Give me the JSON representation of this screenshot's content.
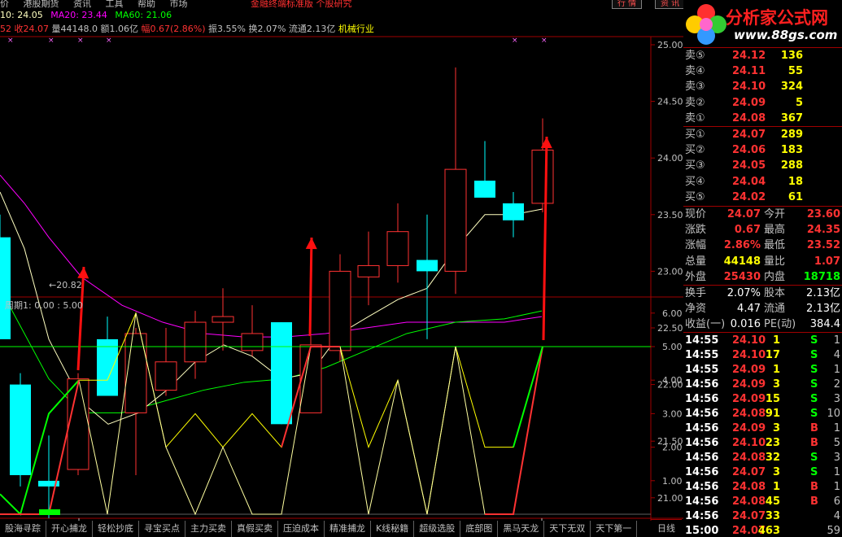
{
  "menu": {
    "items": [
      "价",
      "港股期货",
      "资讯",
      "工具",
      "帮助",
      "市场"
    ],
    "title": "金融终端标准版 个股研究",
    "right_buttons": [
      "行 情",
      "资 讯"
    ]
  },
  "watermark": {
    "brand": "分析家公式网",
    "url": "www.88gs.com"
  },
  "ma_legend": {
    "ma10": "10: 24.05",
    "ma20": "MA20: 23.44",
    "ma60": "MA60: 21.06"
  },
  "quote_line": {
    "close": "52 收24.07",
    "volume": "量44148.0",
    "amount": "额1.06亿",
    "change": "幅0.67(2.86%)",
    "amplitude": "振3.55%",
    "turnover": "换2.07%",
    "float": "流通2.13亿",
    "sector": "机械行业"
  },
  "price_low_label": "←20.82",
  "indicator_label": "周期1: 0.00 : 5.00",
  "price_axis": [
    "25.00",
    "24.50",
    "24.00",
    "23.50",
    "23.00",
    "22.50",
    "22.00",
    "21.50",
    "21.00"
  ],
  "ind_axis": [
    "6.00",
    "5.00",
    "4.00",
    "3.00",
    "2.00",
    "1.00"
  ],
  "bottom_markers": [
    "4",
    "5"
  ],
  "colors": {
    "red": "#ff3232",
    "cyan": "#00ffff",
    "yellow": "#ffff00",
    "green": "#00ff00",
    "grid": "#a00000",
    "ma10": "#ffffc0",
    "ma20": "#ff00ff",
    "ma60": "#00ff00"
  },
  "order_book": {
    "asks": [
      {
        "label": "卖⑤",
        "price": "24.12",
        "vol": "136"
      },
      {
        "label": "卖④",
        "price": "24.11",
        "vol": "55"
      },
      {
        "label": "卖③",
        "price": "24.10",
        "vol": "324"
      },
      {
        "label": "卖②",
        "price": "24.09",
        "vol": "5"
      },
      {
        "label": "卖①",
        "price": "24.08",
        "vol": "367"
      }
    ],
    "bids": [
      {
        "label": "买①",
        "price": "24.07",
        "vol": "289"
      },
      {
        "label": "买②",
        "price": "24.06",
        "vol": "183"
      },
      {
        "label": "买③",
        "price": "24.05",
        "vol": "288"
      },
      {
        "label": "买④",
        "price": "24.04",
        "vol": "18"
      },
      {
        "label": "买⑤",
        "price": "24.02",
        "vol": "61"
      }
    ]
  },
  "quote_stats": [
    {
      "l1": "现价",
      "v1": "24.07",
      "l2": "今开",
      "v2": "23.60"
    },
    {
      "l1": "涨跌",
      "v1": "0.67",
      "l2": "最高",
      "v2": "24.35"
    },
    {
      "l1": "涨幅",
      "v1": "2.86%",
      "l2": "最低",
      "v2": "23.52"
    },
    {
      "l1": "总量",
      "v1": "44148",
      "l2": "量比",
      "v2": "1.07"
    },
    {
      "l1": "外盘",
      "v1": "25430",
      "l2": "内盘",
      "v2": "18718"
    }
  ],
  "fundamentals": [
    {
      "l1": "换手",
      "v1": "2.07%",
      "l2": "股本",
      "v2": "2.13亿"
    },
    {
      "l1": "净资",
      "v1": "4.47",
      "l2": "流通",
      "v2": "2.13亿"
    },
    {
      "l1": "收益(一)",
      "v1": "0.016",
      "l2": "PE(动)",
      "v2": "384.4"
    }
  ],
  "ticks": [
    {
      "time": "14:55",
      "price": "24.10",
      "vol": "1",
      "side": "S",
      "n": "1"
    },
    {
      "time": "14:55",
      "price": "24.10",
      "vol": "17",
      "side": "S",
      "n": "4"
    },
    {
      "time": "14:55",
      "price": "24.09",
      "vol": "1",
      "side": "S",
      "n": "1"
    },
    {
      "time": "14:56",
      "price": "24.09",
      "vol": "3",
      "side": "S",
      "n": "2"
    },
    {
      "time": "14:56",
      "price": "24.09",
      "vol": "15",
      "side": "S",
      "n": "3"
    },
    {
      "time": "14:56",
      "price": "24.08",
      "vol": "91",
      "side": "S",
      "n": "10"
    },
    {
      "time": "14:56",
      "price": "24.09",
      "vol": "3",
      "side": "B",
      "n": "1"
    },
    {
      "time": "14:56",
      "price": "24.10",
      "vol": "23",
      "side": "B",
      "n": "5"
    },
    {
      "time": "14:56",
      "price": "24.08",
      "vol": "32",
      "side": "S",
      "n": "3"
    },
    {
      "time": "14:56",
      "price": "24.07",
      "vol": "3",
      "side": "S",
      "n": "1"
    },
    {
      "time": "14:56",
      "price": "24.08",
      "vol": "1",
      "side": "B",
      "n": "1"
    },
    {
      "time": "14:56",
      "price": "24.08",
      "vol": "45",
      "side": "B",
      "n": "6"
    },
    {
      "time": "14:56",
      "price": "24.07",
      "vol": "33",
      "side": "",
      "n": "4"
    },
    {
      "time": "15:00",
      "price": "24.07",
      "vol": "463",
      "side": "",
      "n": "59"
    }
  ],
  "status_tabs": [
    "股海寻踪",
    "开心捕龙",
    "轻松抄底",
    "寻宝买点",
    "主力买卖",
    "真假买卖",
    "压迫成本",
    "精准捕龙",
    "K线秘籍",
    "超级选股",
    "底部图",
    "黑马天龙",
    "天下无双",
    "天下第一"
  ],
  "day_button": "日线"
}
